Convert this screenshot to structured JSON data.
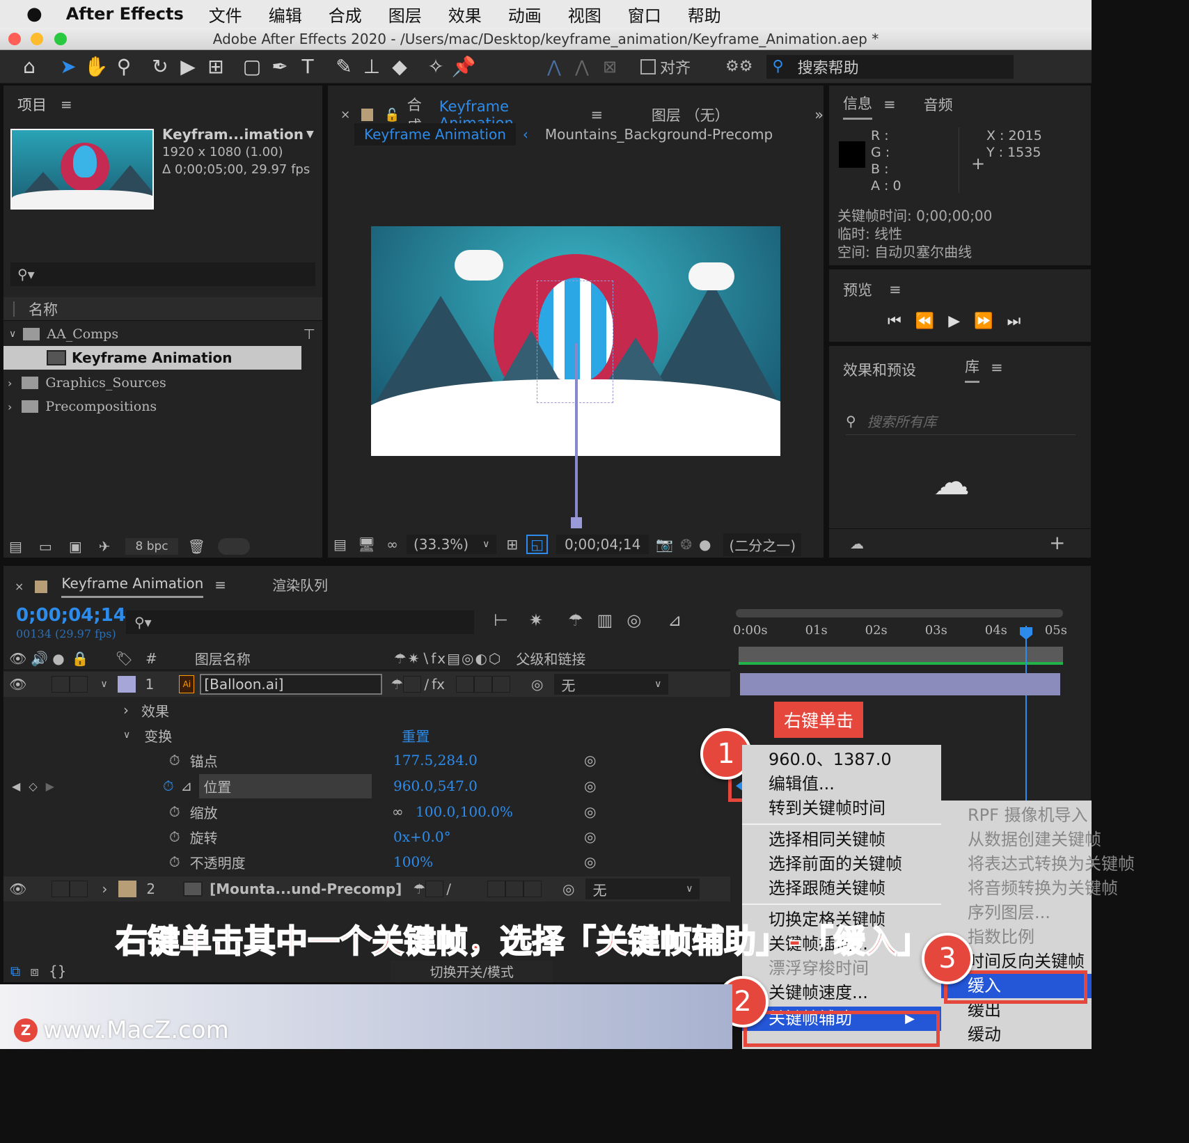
{
  "menubar": {
    "app": "After Effects",
    "items": [
      "文件",
      "编辑",
      "合成",
      "图层",
      "效果",
      "动画",
      "视图",
      "窗口",
      "帮助"
    ]
  },
  "titlebar": {
    "title": "Adobe After Effects 2020 - /Users/mac/Desktop/keyframe_animation/Keyframe_Animation.aep *"
  },
  "toolbar": {
    "align_label": "对齐",
    "search_help": "搜索帮助"
  },
  "project": {
    "tab": "项目",
    "comp_name": "Keyfram...imation",
    "comp_res": "1920 x 1080 (1.00)",
    "comp_dur": "Δ 0;00;05;00, 29.97 fps",
    "col_name": "名称",
    "items": [
      "AA_Comps",
      "Keyframe Animation",
      "Graphics_Sources",
      "Precompositions"
    ],
    "bpc": "8 bpc"
  },
  "composition": {
    "tab_prefix": "合成",
    "tab_name": "Keyframe Animation",
    "layer_tab": "图层 （无）",
    "breadcrumb_active": "Keyframe Animation",
    "breadcrumb_other": "Mountains_Background-Precomp",
    "zoom": "(33.3%)",
    "timecode": "0;00;04;14",
    "resolution": "(二分之一)"
  },
  "info": {
    "tab": "信息",
    "tab2": "音频",
    "r": "R :",
    "g": "G :",
    "b": "B :",
    "a": "A :  0",
    "x": "X : 2015",
    "y": "Y :  1535",
    "kf_time": "关键帧时间: 0;00;00;00",
    "temporal": "临时: 线性",
    "spatial": "空间: 自动贝塞尔曲线",
    "color_swatch": "#000000"
  },
  "preview": {
    "tab": "预览"
  },
  "effects": {
    "tab": "效果和预设",
    "tab2": "库",
    "search_placeholder": "搜索所有库"
  },
  "timeline": {
    "tab": "Keyframe Animation",
    "tab2": "渲染队列",
    "timecode": "0;00;04;14",
    "frame": "00134 (29.97 fps)",
    "col_num": "#",
    "col_layer": "图层名称",
    "col_parent": "父级和链接",
    "ruler": [
      "0:00s",
      "01s",
      "02s",
      "03s",
      "04s",
      "05s"
    ],
    "layer1": {
      "num": "1",
      "name": "[Balloon.ai]",
      "parent": "无"
    },
    "effects_label": "效果",
    "transform_label": "变换",
    "reset_label": "重置",
    "props": [
      {
        "name": "锚点",
        "value": "177.5,284.0"
      },
      {
        "name": "位置",
        "value": "960.0,547.0"
      },
      {
        "name": "缩放",
        "value": "100.0,100.0%"
      },
      {
        "name": "旋转",
        "value": "0x+0.0°"
      },
      {
        "name": "不透明度",
        "value": "100%"
      }
    ],
    "layer2": {
      "num": "2",
      "name": "[Mounta...und-Precomp]",
      "parent": "无"
    },
    "switch_mode": "切换开关/模式"
  },
  "context_menu": {
    "items": [
      "960.0、1387.0",
      "编辑值...",
      "转到关键帧时间",
      "选择相同关键帧",
      "选择前面的关键帧",
      "选择跟随关键帧",
      "切换定格关键帧",
      "关键帧插值...",
      "漂浮穿梭时间",
      "关键帧速度...",
      "关键帧辅助"
    ]
  },
  "submenu": {
    "items": [
      "RPF 摄像机导入",
      "从数据创建关键帧",
      "将表达式转换为关键帧",
      "将音频转换为关键帧",
      "序列图层...",
      "指数比例",
      "时间反向关键帧",
      "缓入",
      "缓出",
      "缓动"
    ]
  },
  "annotations": {
    "callout": "右键单击",
    "step1": "1",
    "step2": "2",
    "step3": "3",
    "caption": "右键单击其中一个关键帧，选择「关键帧辅助」-「缓入」",
    "watermark": "www.MacZ.com",
    "logo_letter": "Z"
  },
  "colors": {
    "accent": "#2d8ceb",
    "annotation": "#e5473d",
    "selection": "#2456d8"
  }
}
